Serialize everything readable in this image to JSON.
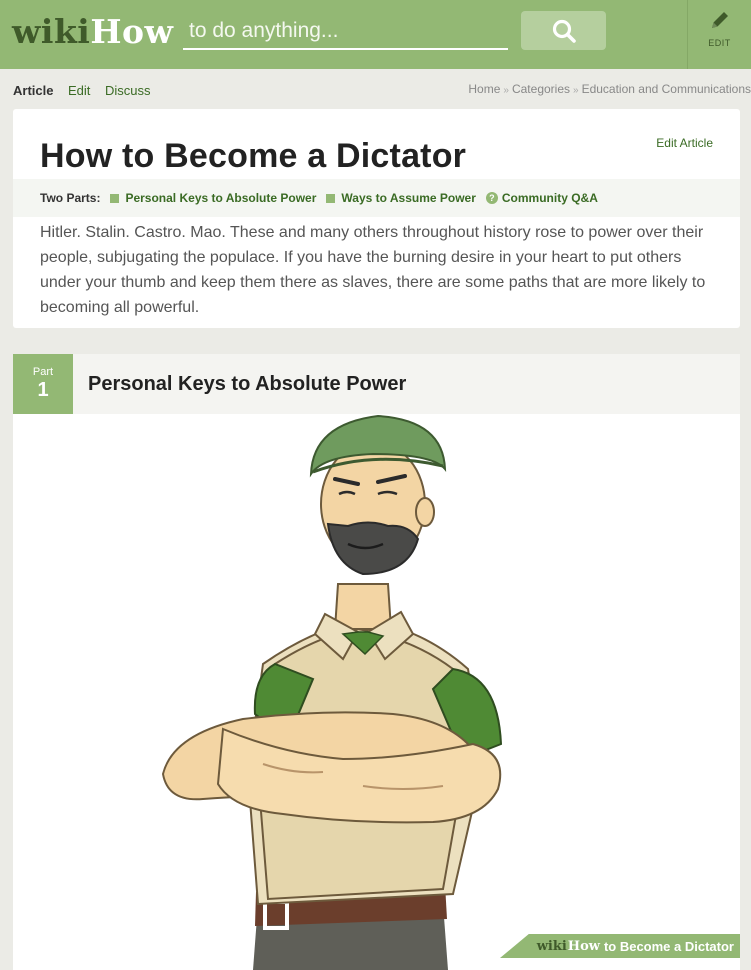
{
  "header": {
    "logo_wiki": "wiki",
    "logo_how": "How",
    "search_placeholder": "to do anything...",
    "search_icon": "search-icon",
    "edit_icon": "pencil-icon",
    "edit_label": "EDIT"
  },
  "tabs": [
    {
      "label": "Article",
      "active": true
    },
    {
      "label": "Edit",
      "active": false
    },
    {
      "label": "Discuss",
      "active": false
    }
  ],
  "breadcrumb": [
    "Home",
    "Categories",
    "Education and Communications"
  ],
  "article": {
    "title": "How to Become a Dictator",
    "edit_link": "Edit Article",
    "parts_label": "Two Parts:",
    "parts": [
      "Personal Keys to Absolute Power",
      "Ways to Assume Power",
      "Community Q&A"
    ],
    "intro": "Hitler. Stalin. Castro. Mao. These and many others throughout history rose to power over their people, subjugating the populace. If you have the burning desire in your heart to put others under your thumb and keep them there as slaves, there are some paths that are more likely to becoming all powerful."
  },
  "part1": {
    "label": "Part",
    "number": "1",
    "title": "Personal Keys to Absolute Power"
  },
  "watermark": {
    "wiki": "wiki",
    "how": "How",
    "text": "to Become a Dictator"
  },
  "colors": {
    "brand_green": "#93b874",
    "dark_green": "#3f5a2a",
    "link_green": "#3a6b24"
  }
}
